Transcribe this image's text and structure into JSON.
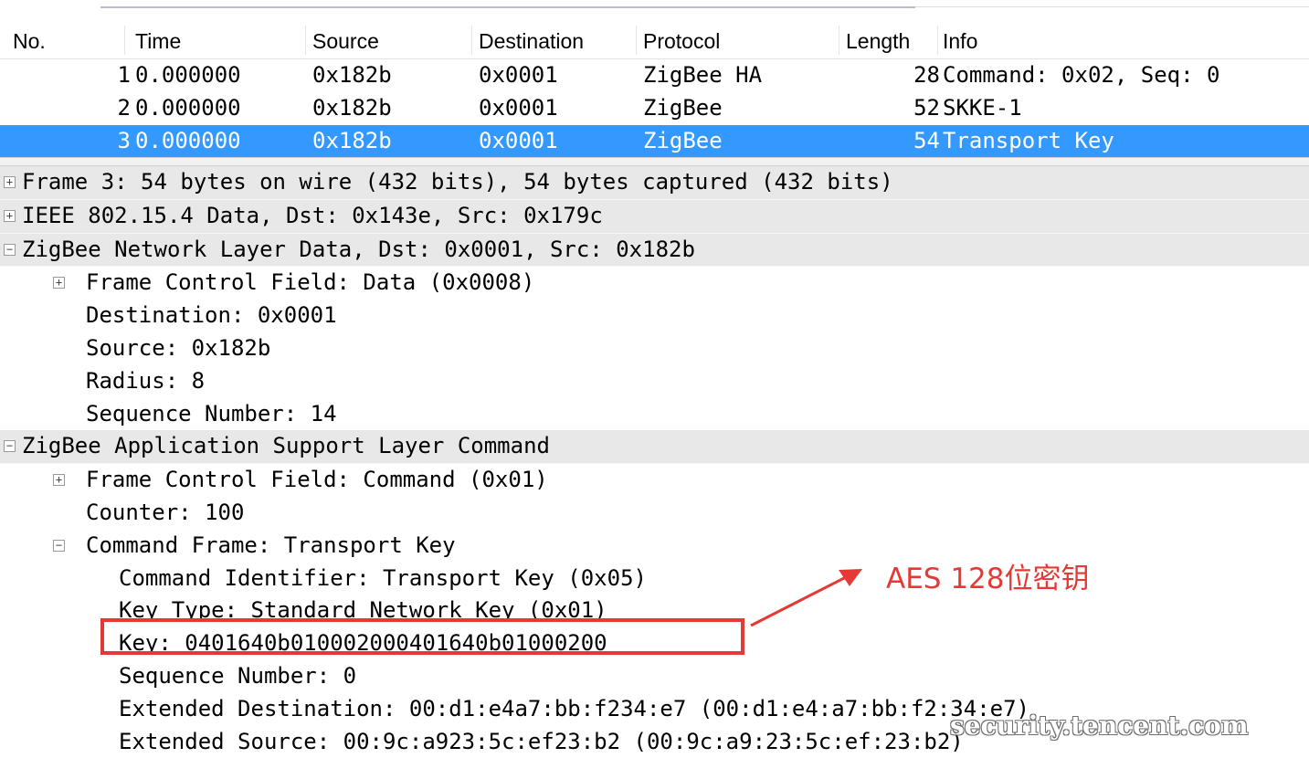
{
  "packet_list": {
    "columns": [
      "No.",
      "Time",
      "Source",
      "Destination",
      "Protocol",
      "Length",
      "Info"
    ],
    "rows": [
      {
        "no": "1",
        "time": "0.000000",
        "source": "0x182b",
        "destination": "0x0001",
        "protocol": "ZigBee HA",
        "length": "28",
        "info": "Command: 0x02, Seq: 0",
        "selected": false
      },
      {
        "no": "2",
        "time": "0.000000",
        "source": "0x182b",
        "destination": "0x0001",
        "protocol": "ZigBee",
        "length": "52",
        "info": "SKKE-1",
        "selected": false
      },
      {
        "no": "3",
        "time": "0.000000",
        "source": "0x182b",
        "destination": "0x0001",
        "protocol": "ZigBee",
        "length": "54",
        "info": "Transport Key",
        "selected": true
      }
    ]
  },
  "details": [
    {
      "text": "Frame 3: 54 bytes on wire (432 bits), 54 bytes captured (432 bits)",
      "level": 0,
      "toggle": "+"
    },
    {
      "text": "IEEE 802.15.4 Data, Dst: 0x143e, Src: 0x179c",
      "level": 0,
      "toggle": "+"
    },
    {
      "text": "ZigBee Network Layer Data, Dst: 0x0001, Src: 0x182b",
      "level": 0,
      "toggle": "-"
    },
    {
      "text": "Frame Control Field: Data (0x0008)",
      "level": 1,
      "toggle": "+"
    },
    {
      "text": "Destination: 0x0001",
      "level": 1,
      "toggle": ""
    },
    {
      "text": "Source: 0x182b",
      "level": 1,
      "toggle": ""
    },
    {
      "text": "Radius: 8",
      "level": 1,
      "toggle": ""
    },
    {
      "text": "Sequence Number: 14",
      "level": 1,
      "toggle": ""
    },
    {
      "text": "ZigBee Application Support Layer Command",
      "level": 0,
      "toggle": "-"
    },
    {
      "text": "Frame Control Field: Command (0x01)",
      "level": 1,
      "toggle": "+"
    },
    {
      "text": "Counter: 100",
      "level": 1,
      "toggle": ""
    },
    {
      "text": "Command Frame: Transport Key",
      "level": 1,
      "toggle": "-"
    },
    {
      "text": "Command Identifier: Transport Key (0x05)",
      "level": 2,
      "toggle": ""
    },
    {
      "text": "Key Type: Standard Network Key (0x01)",
      "level": 2,
      "toggle": ""
    },
    {
      "text": "Key: 0401640b010002000401640b01000200",
      "level": 2,
      "toggle": ""
    },
    {
      "text": "Sequence Number: 0",
      "level": 2,
      "toggle": ""
    },
    {
      "text": "Extended Destination: 00:d1:e4a7:bb:f234:e7 (00:d1:e4:a7:bb:f2:34:e7)",
      "level": 2,
      "toggle": ""
    },
    {
      "text": "Extended Source: 00:9c:a923:5c:ef23:b2 (00:9c:a9:23:5c:ef:23:b2)",
      "level": 2,
      "toggle": ""
    }
  ],
  "annotation": {
    "text": "AES 128位密钥",
    "color": "#e53935"
  },
  "watermark": "security.tencent.com",
  "selection_color": "#3399ff"
}
